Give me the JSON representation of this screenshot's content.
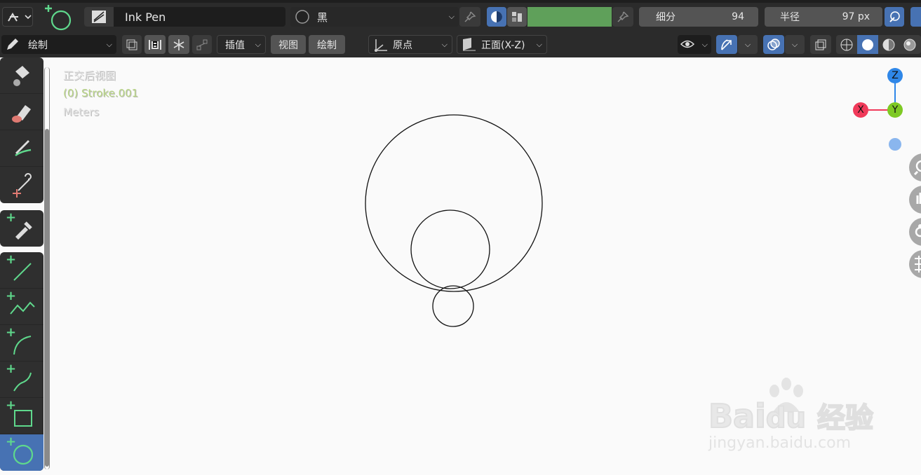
{
  "header_row1": {
    "brush_name": "Ink Pen",
    "material_name": "黑",
    "subdivide_label": "细分",
    "subdivide_value": "94",
    "radius_label": "半径",
    "radius_value": "97 px",
    "color_swatch": "#5fa05a"
  },
  "header_row2": {
    "mode_label": "绘制",
    "interpolate_label": "插值",
    "view_menu": "视图",
    "draw_menu": "绘制",
    "origin_label": "原点",
    "plane_label": "正面(X-Z)"
  },
  "viewport": {
    "view_name": "正交后视图",
    "object_name": "(0) Stroke.001",
    "units": "Meters"
  },
  "gizmo": {
    "z_label": "Z",
    "x_label": "X",
    "y_label": "Y",
    "z_color": "#2f87e8",
    "x_color": "#f03a5a",
    "y_color": "#7ec924"
  },
  "watermark": {
    "brand": "Bai",
    "brand2": "du",
    "brand_cn": "经验",
    "url": "jingyan.baidu.com"
  },
  "toolbar": {
    "tools": [
      "fill-tool",
      "erase-tool",
      "tint-tool",
      "cutter-tool",
      "eyedropper-tool",
      "line-tool",
      "polyline-tool",
      "arc-tool",
      "curve-tool",
      "box-tool",
      "circle-tool"
    ],
    "active_tool": "circle-tool"
  },
  "accent_color": "#4772b3"
}
